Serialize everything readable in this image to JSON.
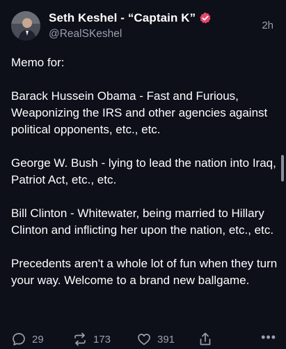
{
  "author": {
    "display_name": "Seth Keshel - “Captain K”",
    "handle": "@RealSKeshel",
    "time": "2h"
  },
  "post": {
    "paragraphs": [
      "Memo for:",
      "Barack Hussein Obama - Fast and Furious, Weaponizing the IRS and other agencies against political opponents, etc., etc.",
      "George W. Bush - lying to lead the nation into Iraq, Patriot Act, etc., etc.",
      "Bill Clinton - Whitewater, being married to Hillary Clinton and inflicting her upon the nation, etc., etc.",
      "Precedents aren't a whole lot of fun when they turn your way. Welcome to a brand new ballgame."
    ]
  },
  "actions": {
    "replies": "29",
    "reposts": "173",
    "likes": "391",
    "more_label": "•••"
  },
  "icons": {
    "verified": "verified-badge-icon",
    "reply": "reply-icon",
    "repost": "repost-icon",
    "like": "heart-icon",
    "share": "share-icon",
    "more": "more-icon"
  },
  "colors": {
    "background": "#0d0f19",
    "verified_badge": "#e5486b",
    "muted_text": "#9aa0ad"
  }
}
